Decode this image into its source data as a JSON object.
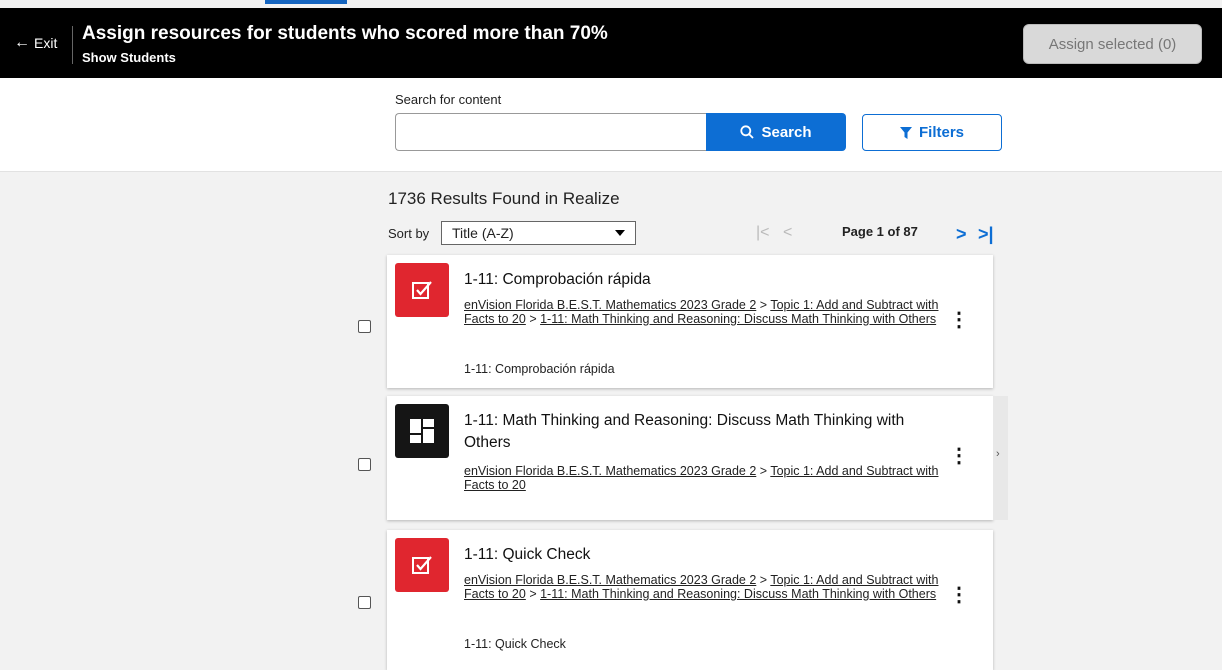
{
  "header": {
    "exit_label": "Exit",
    "title": "Assign resources for students who scored more than 70%",
    "subtitle": "Show Students",
    "assign_label": "Assign selected (0)"
  },
  "search": {
    "label": "Search for content",
    "value": "",
    "button_label": "Search",
    "filters_label": "Filters"
  },
  "results": {
    "title": "1736 Results Found in Realize",
    "sort_label": "Sort by",
    "sort_value": "Title (A-Z)",
    "page_info": "Page 1 of 87"
  },
  "icons": {
    "exit": "arrow-left-icon",
    "search": "search-icon",
    "filter": "filter-icon",
    "quick_check": "checkmark-square-icon",
    "lesson": "layout-grid-icon",
    "more": "kebab-menu-icon"
  },
  "colors": {
    "accent": "#0d6ed4",
    "header_bg": "#000000",
    "quick_check_bg": "#e0262f",
    "lesson_bg": "#151515"
  },
  "cards": [
    {
      "title": "1-11: Comprobación rápida",
      "path1": "enVision Florida B.E.S.T. Mathematics 2023 Grade 2",
      "path2": "Topic 1: Add and Subtract with Facts to 20",
      "path3": "1-11: Math Thinking and Reasoning: Discuss Math Thinking with Others",
      "description": "1-11: Comprobación rápida"
    },
    {
      "title": "1-11: Math Thinking and Reasoning: Discuss Math Thinking with Others",
      "path1": "enVision Florida B.E.S.T. Mathematics 2023 Grade 2",
      "path2": "Topic 1: Add and Subtract with Facts to 20"
    },
    {
      "title": "1-11: Quick Check",
      "path1": "enVision Florida B.E.S.T. Mathematics 2023 Grade 2",
      "path2": "Topic 1: Add and Subtract with Facts to 20",
      "path3": "1-11: Math Thinking and Reasoning: Discuss Math Thinking with Others",
      "description": "1-11: Quick Check"
    }
  ]
}
